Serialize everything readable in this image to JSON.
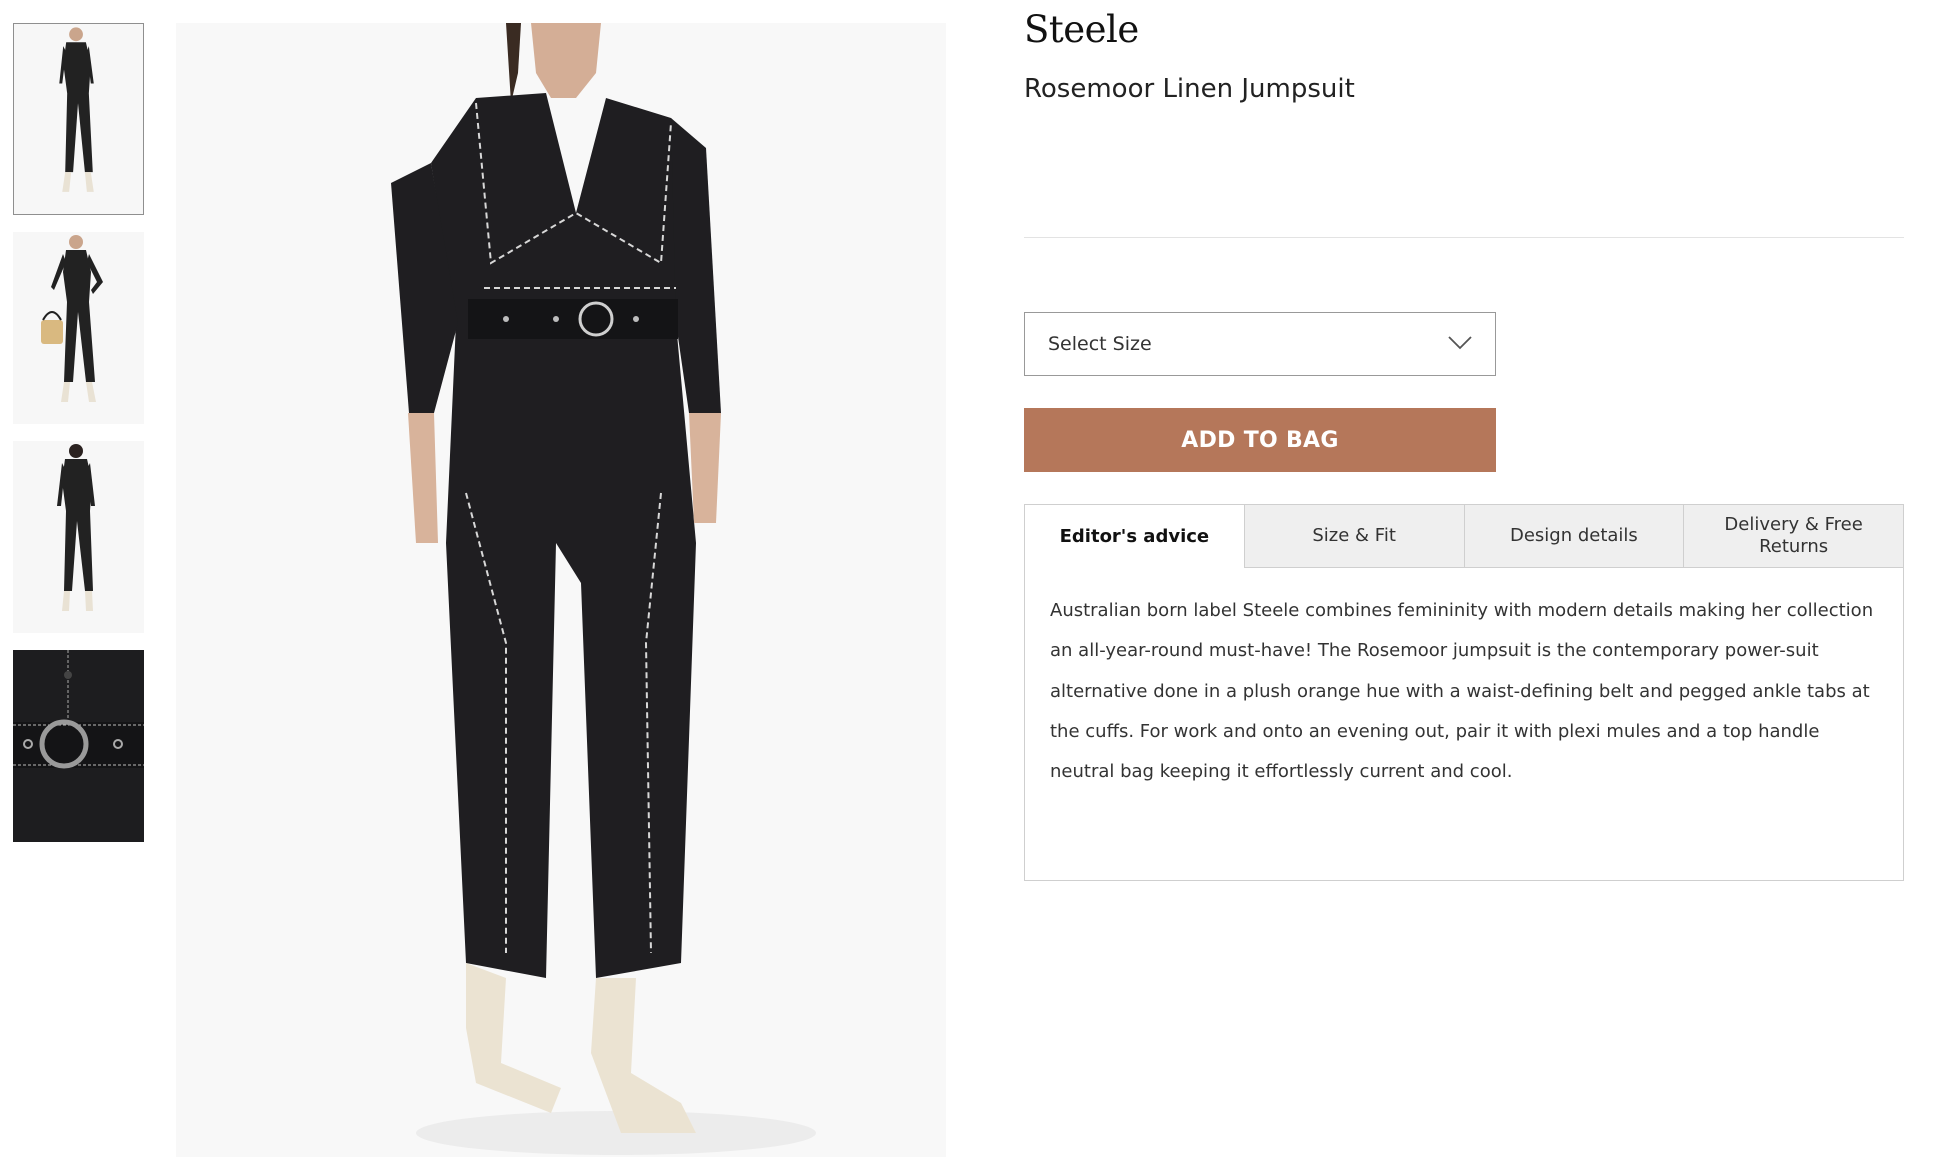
{
  "gallery": {
    "thumbnails": [
      {
        "icon": "jumpsuit-front-thumbnail",
        "active": true
      },
      {
        "icon": "jumpsuit-with-bag-thumbnail",
        "active": false
      },
      {
        "icon": "jumpsuit-back-thumbnail",
        "active": false
      },
      {
        "icon": "belt-detail-thumbnail",
        "active": false
      }
    ],
    "main_image": "jumpsuit-main-photo"
  },
  "product": {
    "brand": "Steele",
    "name": "Rosemoor Linen Jumpsuit"
  },
  "size_select": {
    "label": "Select Size",
    "icon": "chevron-down-icon"
  },
  "add_to_bag": {
    "label": "ADD TO BAG",
    "color": "#b5775a"
  },
  "tabs": [
    {
      "label": "Editor's advice",
      "active": true
    },
    {
      "label": "Size & Fit",
      "active": false
    },
    {
      "label": "Design details",
      "active": false
    },
    {
      "label": "Delivery & Free Returns",
      "active": false
    }
  ],
  "editor_advice": {
    "text": "Australian born label Steele combines femininity with modern details making her collection an all-year-round must-have! The Rosemoor jumpsuit is the contemporary power-suit alternative done in a plush orange hue with a waist-defining belt and pegged ankle tabs at the cuffs. For work and onto an evening out, pair it with plexi mules and a top handle neutral bag keeping it effortlessly current and cool."
  }
}
